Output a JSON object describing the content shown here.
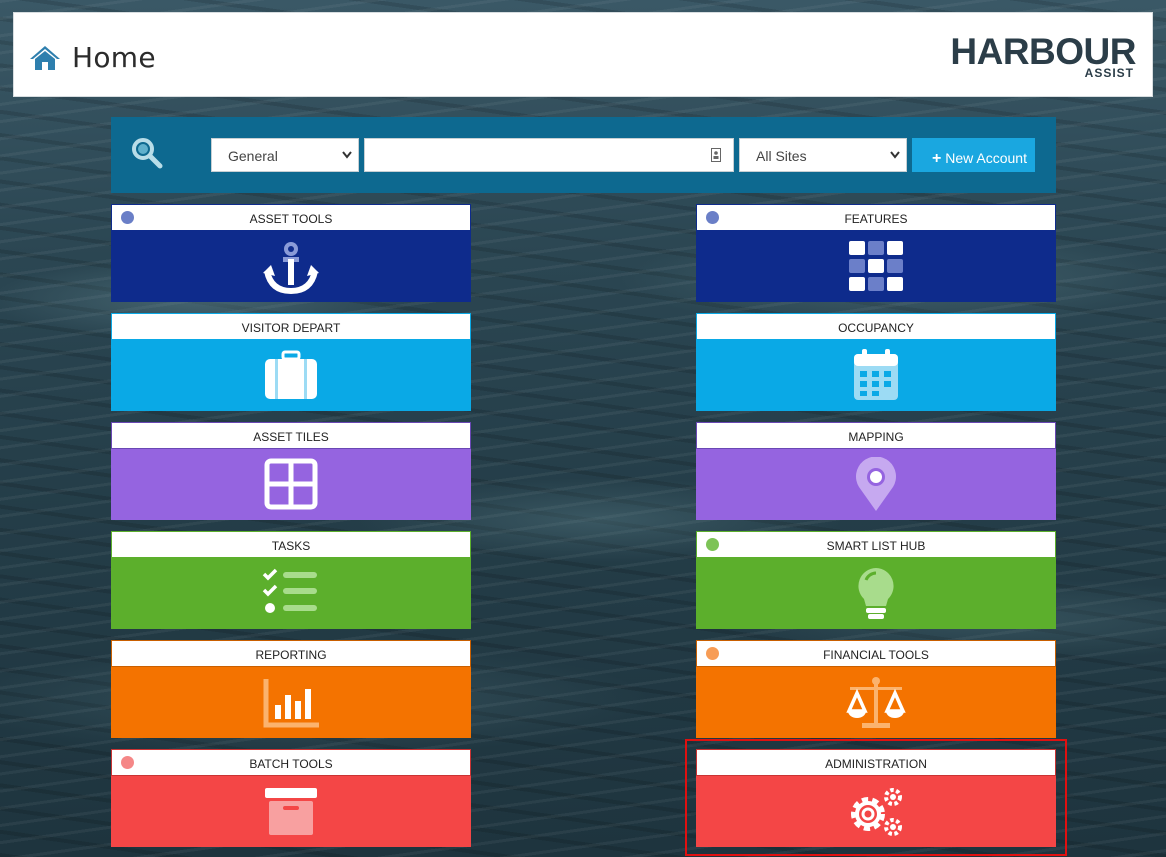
{
  "header": {
    "title": "Home",
    "logo_brand": "HARBOUR",
    "logo_sub": "ASSIST"
  },
  "search": {
    "category_value": "General",
    "query_value": "",
    "site_value": "All Sites",
    "new_account_label": "New Account"
  },
  "tiles": [
    {
      "label": "ASSET TOOLS",
      "color": "#0e2b8c",
      "icon": "anchor-icon"
    },
    {
      "label": "FEATURES",
      "color": "#0e2b8c",
      "icon": "grid-icon"
    },
    {
      "label": "VISITOR DEPART",
      "color": "#0aa9e6",
      "icon": "suitcase-icon"
    },
    {
      "label": "OCCUPANCY",
      "color": "#0aa9e6",
      "icon": "calendar-icon"
    },
    {
      "label": "ASSET TILES",
      "color": "#9564e0",
      "icon": "tiles-icon"
    },
    {
      "label": "MAPPING",
      "color": "#9564e0",
      "icon": "map-pin-icon"
    },
    {
      "label": "TASKS",
      "color": "#5caf2c",
      "icon": "checklist-icon"
    },
    {
      "label": "SMART LIST HUB",
      "color": "#5caf2c",
      "icon": "lightbulb-icon"
    },
    {
      "label": "REPORTING",
      "color": "#f47300",
      "icon": "bar-chart-icon"
    },
    {
      "label": "FINANCIAL TOOLS",
      "color": "#f47300",
      "icon": "scales-icon"
    },
    {
      "label": "BATCH TOOLS",
      "color": "#f44646",
      "icon": "archive-box-icon"
    },
    {
      "label": "ADMINISTRATION",
      "color": "#f44646",
      "icon": "gears-icon"
    }
  ]
}
